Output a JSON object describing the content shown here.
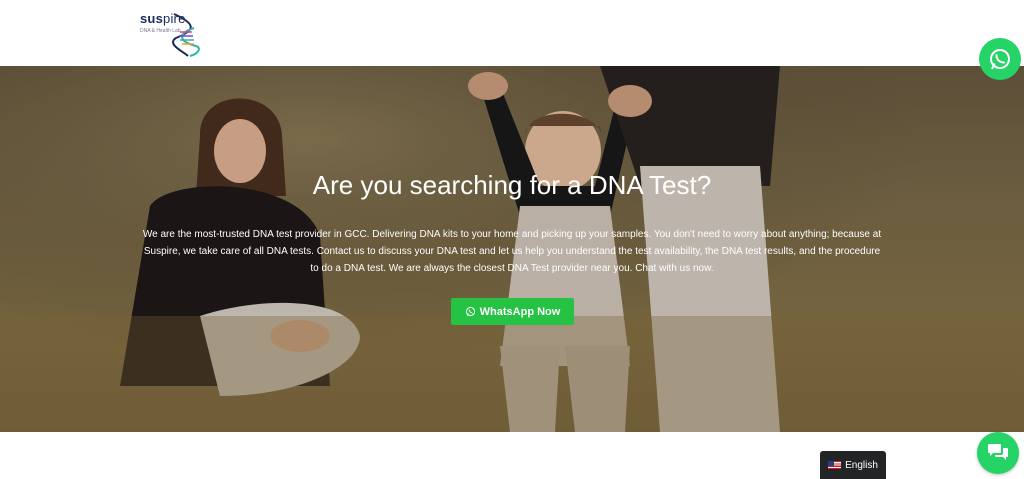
{
  "brand": {
    "name_bold": "sus",
    "name_light": "pire",
    "tagline": "DNA & Health Lab"
  },
  "hero": {
    "title": "Are you searching for a DNA Test?",
    "description": "We are the most-trusted DNA test provider in GCC. Delivering DNA kits to your home and picking up your samples. You don't need to worry about anything; because at Suspire, we take care of all DNA tests. Contact us to discuss your DNA test and let us help you understand the test availability, the DNA test results, and the procedure to do a DNA test. We are always the closest DNA Test provider near you. Chat with us now.",
    "cta_label": "WhatsApp Now"
  },
  "language": {
    "label": "English"
  },
  "colors": {
    "whatsapp": "#25d366",
    "cta": "#25c244",
    "brand_navy": "#1a2a5a"
  },
  "icons": {
    "floating_top": "whatsapp-icon",
    "floating_bottom": "chat-bubbles-icon",
    "cta": "whatsapp-icon",
    "language": "us-flag-icon"
  }
}
